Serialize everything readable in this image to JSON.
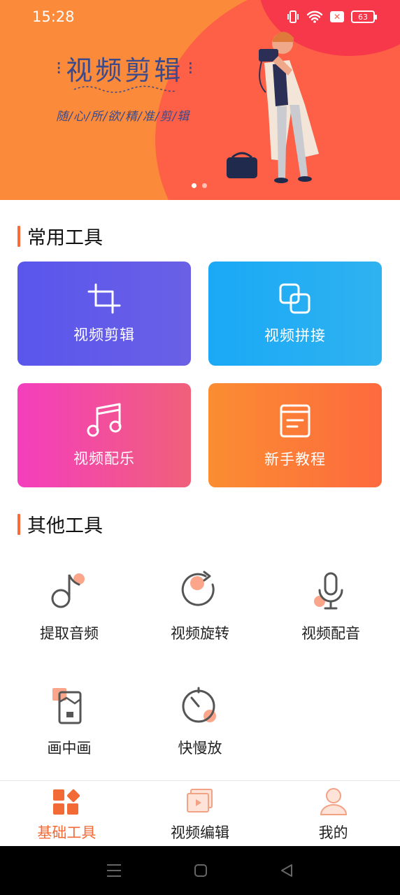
{
  "status_bar": {
    "time": "15:28",
    "battery": "63"
  },
  "banner": {
    "headline": "视频剪辑",
    "subline": "随/心/所/欲/精/准/剪/辑",
    "page_count": 2,
    "active_page": 1
  },
  "common_tools": {
    "title": "常用工具",
    "items": [
      {
        "label": "视频剪辑",
        "icon": "crop-icon"
      },
      {
        "label": "视频拼接",
        "icon": "merge-icon"
      },
      {
        "label": "视频配乐",
        "icon": "music-note-icon"
      },
      {
        "label": "新手教程",
        "icon": "document-icon"
      }
    ]
  },
  "other_tools": {
    "title": "其他工具",
    "items": [
      {
        "label": "提取音频",
        "icon": "note-icon"
      },
      {
        "label": "视频旋转",
        "icon": "rotate-icon"
      },
      {
        "label": "视频配音",
        "icon": "microphone-icon"
      },
      {
        "label": "画中画",
        "icon": "pip-icon"
      },
      {
        "label": "快慢放",
        "icon": "timer-icon"
      }
    ]
  },
  "bottom_nav": {
    "items": [
      {
        "label": "基础工具",
        "icon": "tools-grid-icon",
        "active": true
      },
      {
        "label": "视频编辑",
        "icon": "video-stack-icon",
        "active": false
      },
      {
        "label": "我的",
        "icon": "user-icon",
        "active": false
      }
    ]
  },
  "colors": {
    "accent": "#f26a35",
    "banner_orange": "#fb8a3a",
    "banner_red": "#fd6046",
    "card_purple": "#5a56ec",
    "card_blue": "#1aa9f6",
    "card_pink": "#f43ebd",
    "card_orange": "#fb8d32"
  }
}
